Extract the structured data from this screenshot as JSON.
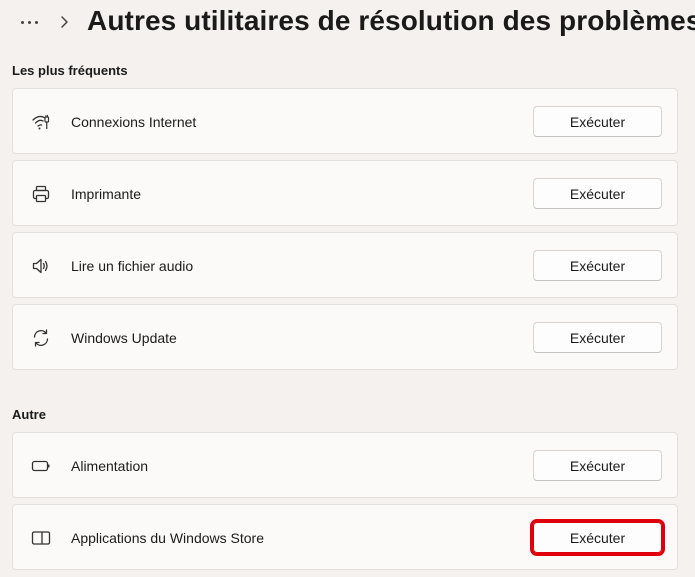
{
  "header": {
    "more_label": "...",
    "title": "Autres utilitaires de résolution des problèmes"
  },
  "sections": [
    {
      "label": "Les plus fréquents",
      "items": [
        {
          "label": "Connexions Internet",
          "icon": "wifi-icon",
          "button": "Exécuter"
        },
        {
          "label": "Imprimante",
          "icon": "printer-icon",
          "button": "Exécuter"
        },
        {
          "label": "Lire un fichier audio",
          "icon": "speaker-icon",
          "button": "Exécuter"
        },
        {
          "label": "Windows Update",
          "icon": "sync-icon",
          "button": "Exécuter"
        }
      ]
    },
    {
      "label": "Autre",
      "items": [
        {
          "label": "Alimentation",
          "icon": "battery-icon",
          "button": "Exécuter"
        },
        {
          "label": "Applications du Windows Store",
          "icon": "store-app-icon",
          "button": "Exécuter",
          "highlighted": true
        }
      ]
    }
  ],
  "colors": {
    "background": "#f4f1ee",
    "card": "#fbfaf9",
    "highlight": "#e0000b"
  }
}
